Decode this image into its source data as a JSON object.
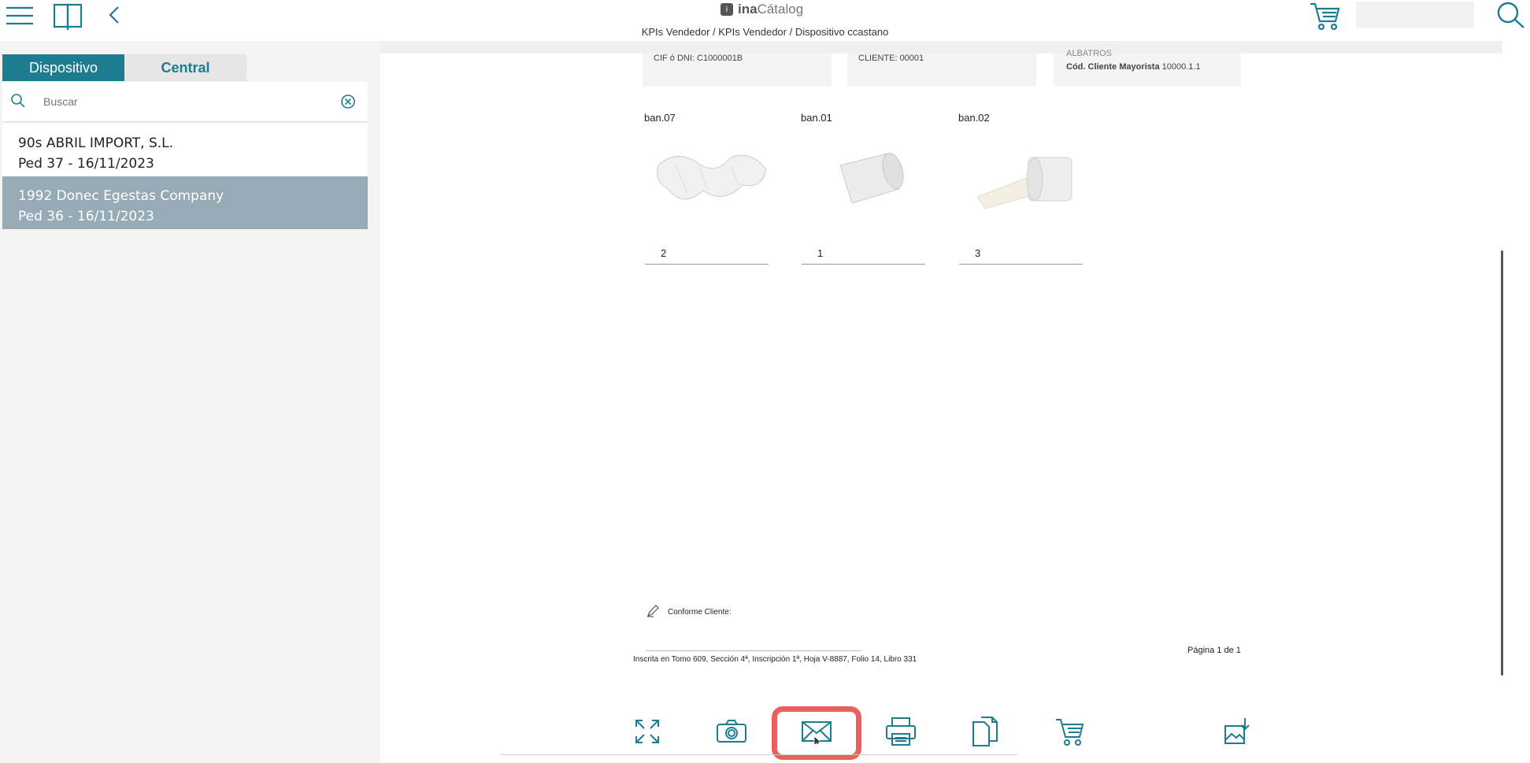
{
  "app": {
    "brand_prefix": "ina",
    "brand_suffix": "Cátalog",
    "breadcrumb": "KPIs Vendedor / KPIs Vendedor / Dispositivo ccastano"
  },
  "topbar": {
    "menu_icon": "hamburger-menu-icon",
    "catalog_icon": "book-icon",
    "back_icon": "chevron-left-icon",
    "cart_icon": "cart-icon",
    "search_icon": "search-icon"
  },
  "sidebar": {
    "tabs": [
      {
        "label": "Dispositivo",
        "active": true
      },
      {
        "label": "Central",
        "active": false
      }
    ],
    "search": {
      "placeholder": "Buscar",
      "value": ""
    },
    "orders": [
      {
        "line1": "90s ABRIL IMPORT, S.L.",
        "line2": "Ped 37 - 16/11/2023",
        "selected": false
      },
      {
        "line1": "1992 Donec Egestas Company",
        "line2": "Ped 36 - 16/11/2023",
        "selected": true
      }
    ]
  },
  "document": {
    "info": {
      "cif": "CIF ó DNI: C1000001B",
      "cliente": "CLIENTE: 00001",
      "partial_name": "ALBATROS",
      "cod_label": "Cód. Cliente Mayorista",
      "cod_value": "10000.1.1"
    },
    "products": [
      {
        "code": "ban.07",
        "qty": "2"
      },
      {
        "code": "ban.01",
        "qty": "1"
      },
      {
        "code": "ban.02",
        "qty": "3"
      }
    ],
    "signature_label": "Conforme Cliente:",
    "footer_registry": "Inscrita en Tomo 609, Sección 4ª, Inscripción 1ª, Hoja V-8887, Folio 14, Libro 331",
    "page_indicator": "Página 1 de 1"
  },
  "toolbar": {
    "buttons": [
      {
        "name": "expand",
        "icon": "expand-icon"
      },
      {
        "name": "camera",
        "icon": "camera-icon"
      },
      {
        "name": "email",
        "icon": "envelope-icon",
        "highlighted": true
      },
      {
        "name": "print",
        "icon": "printer-icon"
      },
      {
        "name": "copy",
        "icon": "copy-icon"
      },
      {
        "name": "cart",
        "icon": "cart-icon"
      },
      {
        "name": "export-image",
        "icon": "image-download-icon"
      }
    ]
  },
  "colors": {
    "accent": "#1d7d90",
    "selected_row": "#96abb5",
    "highlight": "#e8615a"
  }
}
